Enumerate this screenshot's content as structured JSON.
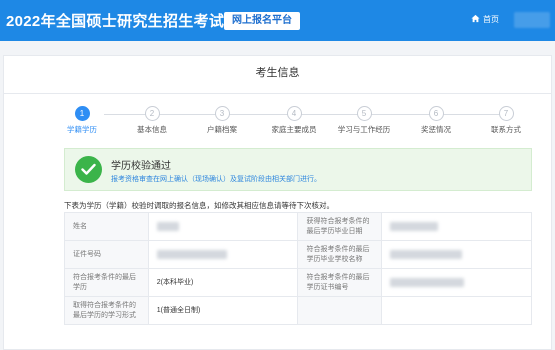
{
  "header": {
    "title": "2022年全国硕士研究生招生考试",
    "platform": "网上报名平台",
    "home": "首页"
  },
  "panel": {
    "title": "考生信息"
  },
  "steps": [
    {
      "num": "1",
      "label": "学籍学历",
      "active": true
    },
    {
      "num": "2",
      "label": "基本信息",
      "active": false
    },
    {
      "num": "3",
      "label": "户籍档案",
      "active": false
    },
    {
      "num": "4",
      "label": "家庭主要成员",
      "active": false
    },
    {
      "num": "5",
      "label": "学习与工作经历",
      "active": false
    },
    {
      "num": "6",
      "label": "奖惩情况",
      "active": false
    },
    {
      "num": "7",
      "label": "联系方式",
      "active": false
    }
  ],
  "alert": {
    "title": "学历校验通过",
    "note": "报考资格审查在网上确认（现场确认）及复试阶段由相关部门进行。"
  },
  "intro": "下表为学历（学籍）校验时调取的报名信息，如修改其相应信息请等待下次核对。",
  "table": {
    "name_label": "姓名",
    "grad_date_label": "获得符合报考条件的最后学历毕业日期",
    "cert_no_label": "证件号码",
    "school_label": "符合报考条件的最后学历毕业学校名称",
    "degree_label": "符合报考条件的最后学历",
    "degree_value": "2(本科毕业)",
    "cert_label": "符合报考条件的最后学历证书编号",
    "study_mode_label": "取得符合报考条件的最后学历的学习形式",
    "study_mode_value": "1(普通全日制)"
  }
}
